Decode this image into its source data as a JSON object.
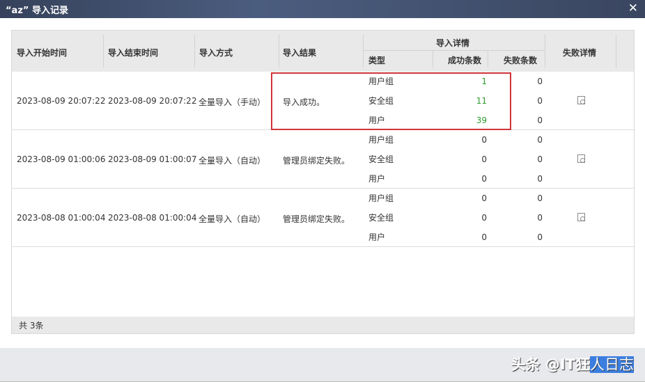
{
  "dialog": {
    "title": "“az” 导入记录"
  },
  "header": {
    "start": "导入开始时间",
    "end": "导入结束时间",
    "method": "导入方式",
    "result": "导入结果",
    "details": "导入详情",
    "type": "类型",
    "success": "成功条数",
    "fail": "失败条数",
    "fail_details": "失败详情"
  },
  "rows": [
    {
      "start": "2023-08-09 20:07:22",
      "end": "2023-08-09 20:07:22",
      "method": "全量导入（手动）",
      "result": "导入成功。",
      "items": [
        {
          "type": "用户组",
          "success": "1",
          "fail": "0"
        },
        {
          "type": "安全组",
          "success": "11",
          "fail": "0"
        },
        {
          "type": "用户",
          "success": "39",
          "fail": "0"
        }
      ]
    },
    {
      "start": "2023-08-09 01:00:06",
      "end": "2023-08-09 01:00:07",
      "method": "全量导入（自动）",
      "result": "管理员绑定失败。",
      "items": [
        {
          "type": "用户组",
          "success": "0",
          "fail": "0"
        },
        {
          "type": "安全组",
          "success": "0",
          "fail": "0"
        },
        {
          "type": "用户",
          "success": "0",
          "fail": "0"
        }
      ]
    },
    {
      "start": "2023-08-08 01:00:04",
      "end": "2023-08-08 01:00:04",
      "method": "全量导入（自动）",
      "result": "管理员绑定失败。",
      "items": [
        {
          "type": "用户组",
          "success": "0",
          "fail": "0"
        },
        {
          "type": "安全组",
          "success": "0",
          "fail": "0"
        },
        {
          "type": "用户",
          "success": "0",
          "fail": "0"
        }
      ]
    }
  ],
  "footer": {
    "total": "共 3条"
  },
  "watermark": {
    "prefix": "头条 @IT狂",
    "highlight": "人日志"
  },
  "colors": {
    "success": "#2e9a2e",
    "highlight_box": "#d0343a"
  }
}
